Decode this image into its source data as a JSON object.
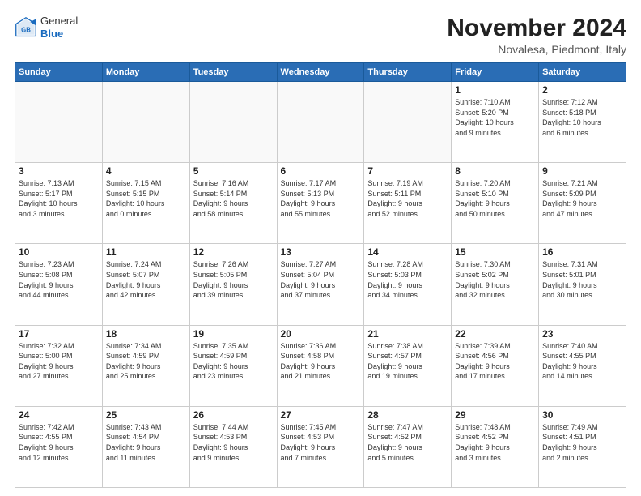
{
  "header": {
    "logo_general": "General",
    "logo_blue": "Blue",
    "month_title": "November 2024",
    "location": "Novalesa, Piedmont, Italy"
  },
  "weekdays": [
    "Sunday",
    "Monday",
    "Tuesday",
    "Wednesday",
    "Thursday",
    "Friday",
    "Saturday"
  ],
  "weeks": [
    [
      {
        "day": "",
        "info": ""
      },
      {
        "day": "",
        "info": ""
      },
      {
        "day": "",
        "info": ""
      },
      {
        "day": "",
        "info": ""
      },
      {
        "day": "",
        "info": ""
      },
      {
        "day": "1",
        "info": "Sunrise: 7:10 AM\nSunset: 5:20 PM\nDaylight: 10 hours\nand 9 minutes."
      },
      {
        "day": "2",
        "info": "Sunrise: 7:12 AM\nSunset: 5:18 PM\nDaylight: 10 hours\nand 6 minutes."
      }
    ],
    [
      {
        "day": "3",
        "info": "Sunrise: 7:13 AM\nSunset: 5:17 PM\nDaylight: 10 hours\nand 3 minutes."
      },
      {
        "day": "4",
        "info": "Sunrise: 7:15 AM\nSunset: 5:15 PM\nDaylight: 10 hours\nand 0 minutes."
      },
      {
        "day": "5",
        "info": "Sunrise: 7:16 AM\nSunset: 5:14 PM\nDaylight: 9 hours\nand 58 minutes."
      },
      {
        "day": "6",
        "info": "Sunrise: 7:17 AM\nSunset: 5:13 PM\nDaylight: 9 hours\nand 55 minutes."
      },
      {
        "day": "7",
        "info": "Sunrise: 7:19 AM\nSunset: 5:11 PM\nDaylight: 9 hours\nand 52 minutes."
      },
      {
        "day": "8",
        "info": "Sunrise: 7:20 AM\nSunset: 5:10 PM\nDaylight: 9 hours\nand 50 minutes."
      },
      {
        "day": "9",
        "info": "Sunrise: 7:21 AM\nSunset: 5:09 PM\nDaylight: 9 hours\nand 47 minutes."
      }
    ],
    [
      {
        "day": "10",
        "info": "Sunrise: 7:23 AM\nSunset: 5:08 PM\nDaylight: 9 hours\nand 44 minutes."
      },
      {
        "day": "11",
        "info": "Sunrise: 7:24 AM\nSunset: 5:07 PM\nDaylight: 9 hours\nand 42 minutes."
      },
      {
        "day": "12",
        "info": "Sunrise: 7:26 AM\nSunset: 5:05 PM\nDaylight: 9 hours\nand 39 minutes."
      },
      {
        "day": "13",
        "info": "Sunrise: 7:27 AM\nSunset: 5:04 PM\nDaylight: 9 hours\nand 37 minutes."
      },
      {
        "day": "14",
        "info": "Sunrise: 7:28 AM\nSunset: 5:03 PM\nDaylight: 9 hours\nand 34 minutes."
      },
      {
        "day": "15",
        "info": "Sunrise: 7:30 AM\nSunset: 5:02 PM\nDaylight: 9 hours\nand 32 minutes."
      },
      {
        "day": "16",
        "info": "Sunrise: 7:31 AM\nSunset: 5:01 PM\nDaylight: 9 hours\nand 30 minutes."
      }
    ],
    [
      {
        "day": "17",
        "info": "Sunrise: 7:32 AM\nSunset: 5:00 PM\nDaylight: 9 hours\nand 27 minutes."
      },
      {
        "day": "18",
        "info": "Sunrise: 7:34 AM\nSunset: 4:59 PM\nDaylight: 9 hours\nand 25 minutes."
      },
      {
        "day": "19",
        "info": "Sunrise: 7:35 AM\nSunset: 4:59 PM\nDaylight: 9 hours\nand 23 minutes."
      },
      {
        "day": "20",
        "info": "Sunrise: 7:36 AM\nSunset: 4:58 PM\nDaylight: 9 hours\nand 21 minutes."
      },
      {
        "day": "21",
        "info": "Sunrise: 7:38 AM\nSunset: 4:57 PM\nDaylight: 9 hours\nand 19 minutes."
      },
      {
        "day": "22",
        "info": "Sunrise: 7:39 AM\nSunset: 4:56 PM\nDaylight: 9 hours\nand 17 minutes."
      },
      {
        "day": "23",
        "info": "Sunrise: 7:40 AM\nSunset: 4:55 PM\nDaylight: 9 hours\nand 14 minutes."
      }
    ],
    [
      {
        "day": "24",
        "info": "Sunrise: 7:42 AM\nSunset: 4:55 PM\nDaylight: 9 hours\nand 12 minutes."
      },
      {
        "day": "25",
        "info": "Sunrise: 7:43 AM\nSunset: 4:54 PM\nDaylight: 9 hours\nand 11 minutes."
      },
      {
        "day": "26",
        "info": "Sunrise: 7:44 AM\nSunset: 4:53 PM\nDaylight: 9 hours\nand 9 minutes."
      },
      {
        "day": "27",
        "info": "Sunrise: 7:45 AM\nSunset: 4:53 PM\nDaylight: 9 hours\nand 7 minutes."
      },
      {
        "day": "28",
        "info": "Sunrise: 7:47 AM\nSunset: 4:52 PM\nDaylight: 9 hours\nand 5 minutes."
      },
      {
        "day": "29",
        "info": "Sunrise: 7:48 AM\nSunset: 4:52 PM\nDaylight: 9 hours\nand 3 minutes."
      },
      {
        "day": "30",
        "info": "Sunrise: 7:49 AM\nSunset: 4:51 PM\nDaylight: 9 hours\nand 2 minutes."
      }
    ]
  ]
}
